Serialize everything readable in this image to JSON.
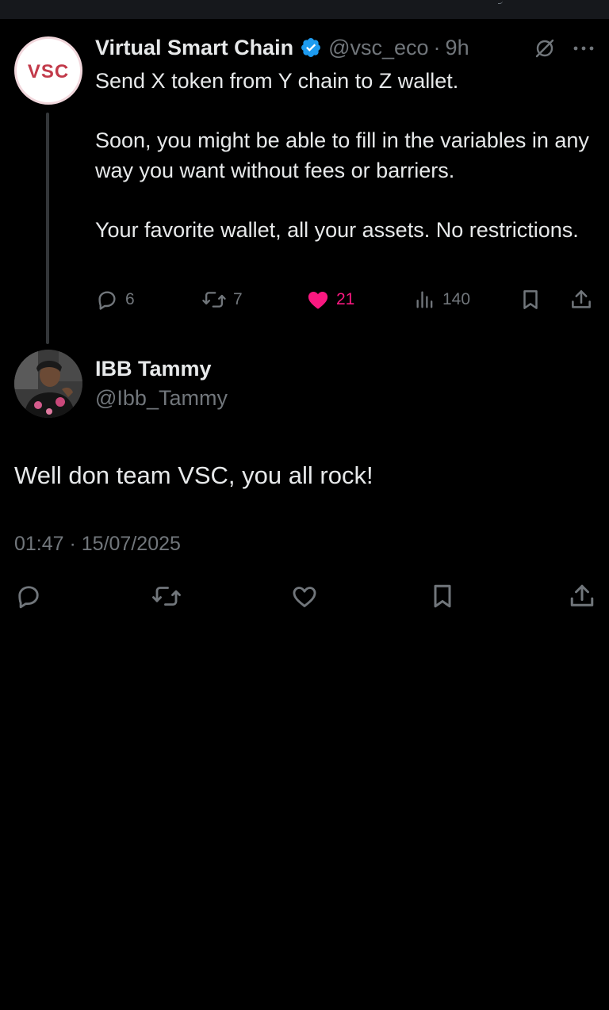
{
  "parent_tweet": {
    "avatar_text": "VSC",
    "name": "Virtual Smart Chain",
    "handle": "@vsc_eco",
    "separator": "·",
    "time": "9h",
    "body": [
      "Send X token from Y chain to Z wallet.",
      "Soon, you might be able to fill in the variables in any way you want without fees or barriers.",
      "Your favorite wallet, all your assets. No restrictions."
    ],
    "actions": {
      "replies": "6",
      "reposts": "7",
      "likes": "21",
      "views": "140"
    }
  },
  "reply_tweet": {
    "name": "IBB Tammy",
    "handle": "@Ibb_Tammy",
    "text": "Well don team VSC, you all rock!",
    "timestamp": "01:47 · 15/07/2025"
  },
  "colors": {
    "background": "#000000",
    "text_primary": "#e7e9ea",
    "text_secondary": "#71767b",
    "like_active": "#f91880",
    "verified": "#1d9bf0"
  }
}
